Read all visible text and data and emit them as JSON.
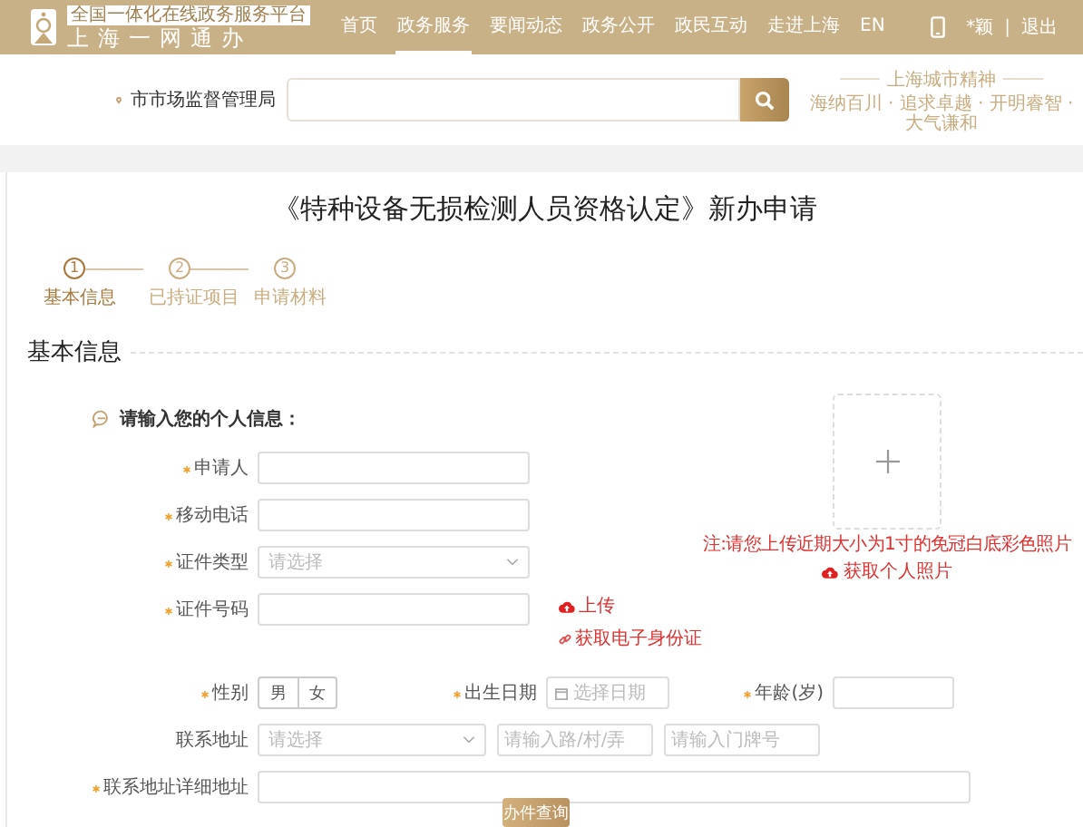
{
  "header": {
    "logo": {
      "tagline": "全国一体化在线政务服务平台",
      "name": "上海一网通办"
    },
    "nav": [
      {
        "label": "首页",
        "selected": false
      },
      {
        "label": "政务服务",
        "selected": true
      },
      {
        "label": "要闻动态",
        "selected": false
      },
      {
        "label": "政务公开",
        "selected": false
      },
      {
        "label": "政民互动",
        "selected": false
      },
      {
        "label": "走进上海",
        "selected": false
      },
      {
        "label": "EN",
        "selected": false
      }
    ],
    "user": {
      "name": "*颖",
      "separator": "|",
      "logout": "退出"
    }
  },
  "search": {
    "department": "市市场监督管理局"
  },
  "slogan": {
    "title": "上海城市精神",
    "subtitle": "海纳百川 · 追求卓越 · 开明睿智 · 大气谦和"
  },
  "title": "《特种设备无损检测人员资格认定》新办申请",
  "steps": [
    {
      "number": "1",
      "label": "基本信息",
      "selected": true
    },
    {
      "number": "2",
      "label": "已持证项目",
      "selected": false
    },
    {
      "number": "3",
      "label": "申请材料",
      "selected": false
    }
  ],
  "section_title": "基本信息",
  "prompt": "请输入您的个人信息：",
  "photo": {
    "note": "注:请您上传近期大小为1寸的免冠白底彩色照片",
    "action": "获取个人照片"
  },
  "rows": [
    {
      "fields": [
        {
          "kind": "text",
          "label": "申请人",
          "required": true
        }
      ]
    },
    {
      "fields": [
        {
          "kind": "text",
          "label": "移动电话",
          "required": true
        }
      ]
    },
    {
      "fields": [
        {
          "kind": "select",
          "label": "证件类型",
          "required": true,
          "placeholder": "请选择"
        }
      ]
    },
    {
      "fields": [
        {
          "kind": "text",
          "label": "证件号码",
          "required": true
        }
      ],
      "links": [
        {
          "kind": "upload",
          "label": "上传"
        },
        {
          "kind": "link",
          "label": "获取电子身份证"
        }
      ]
    },
    {
      "fields": [
        {
          "kind": "toggle",
          "label": "性别",
          "required": true,
          "options": [
            {
              "label": "男",
              "selected": false
            },
            {
              "label": "女",
              "selected": false
            }
          ]
        },
        {
          "kind": "date",
          "label": "出生日期",
          "required": true,
          "placeholder": "选择日期"
        },
        {
          "kind": "text",
          "label": "年龄(岁)",
          "required": true
        }
      ]
    },
    {
      "fields": [
        {
          "kind": "select",
          "label": "联系地址",
          "placeholder": "请选择"
        },
        {
          "kind": "text",
          "placeholder": "请输入路/村/弄"
        },
        {
          "kind": "text",
          "placeholder": "请输入门牌号"
        }
      ]
    },
    {
      "fields": [
        {
          "kind": "wide",
          "label": "联系地址详细地址",
          "required": true
        }
      ]
    }
  ],
  "float_button": "办件查询"
}
